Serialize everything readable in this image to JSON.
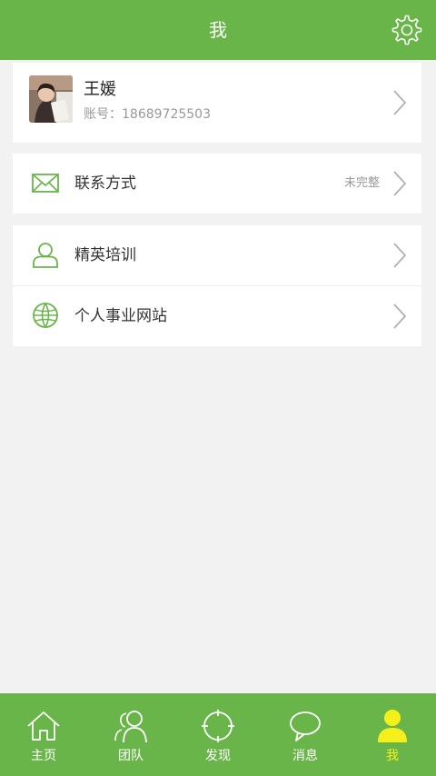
{
  "header": {
    "title": "我",
    "settings_icon": "gear-icon"
  },
  "profile": {
    "name": "王媛",
    "account": "账号：18689725503"
  },
  "contact": {
    "label": "联系方式",
    "status": "未完整",
    "icon": "envelope-icon"
  },
  "menu": [
    {
      "label": "精英培训",
      "icon": "person-icon"
    },
    {
      "label": "个人事业网站",
      "icon": "globe-icon"
    }
  ],
  "tabs": [
    {
      "label": "主页",
      "icon": "home-icon"
    },
    {
      "label": "团队",
      "icon": "team-icon"
    },
    {
      "label": "发现",
      "icon": "compass-icon"
    },
    {
      "label": "消息",
      "icon": "chat-bubble-icon"
    },
    {
      "label": "我",
      "icon": "user-icon",
      "active": true
    }
  ],
  "colors": {
    "primary": "#6ab54a",
    "active_tab": "#f5f01a",
    "background": "#f2f2f2"
  }
}
